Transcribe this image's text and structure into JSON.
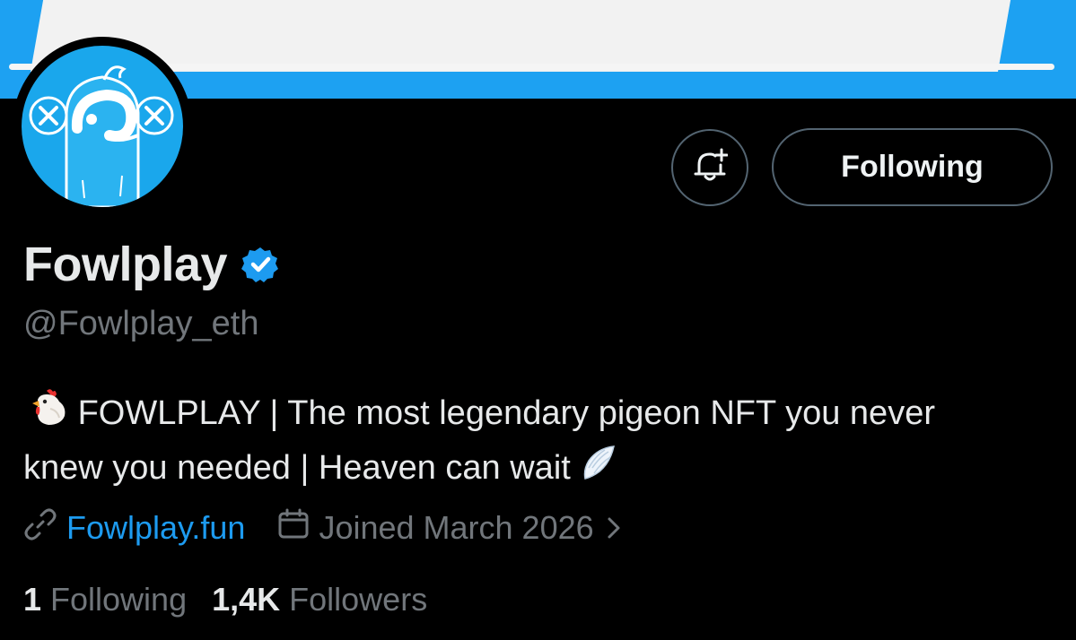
{
  "colors": {
    "background": "#000000",
    "banner": "#1da1f2",
    "accent": "#1d9bf0",
    "text_primary": "#e7e9ea",
    "text_secondary": "#71767b",
    "button_border": "#536471"
  },
  "profile": {
    "display_name": "Fowlplay",
    "verified": true,
    "handle": "@Fowlplay_eth",
    "avatar_icon": "pigeon-avatar",
    "bio": {
      "line1_text": "FOWLPLAY | The most legendary pigeon NFT you never",
      "line2_text": "knew you needed | Heaven can wait",
      "leading_emoji": "chicken-emoji",
      "trailing_emoji": "wing-emoji"
    },
    "website": {
      "label": "Fowlplay.fun",
      "icon": "link-icon"
    },
    "joined": {
      "label": "Joined March 2026",
      "icon": "calendar-icon",
      "chevron_icon": "chevron-right-icon"
    }
  },
  "actions": {
    "notify_icon": "bell-plus-icon",
    "following_label": "Following"
  },
  "stats": {
    "following_count": "1",
    "following_label": "Following",
    "followers_count": "1,4K",
    "followers_label": "Followers"
  }
}
